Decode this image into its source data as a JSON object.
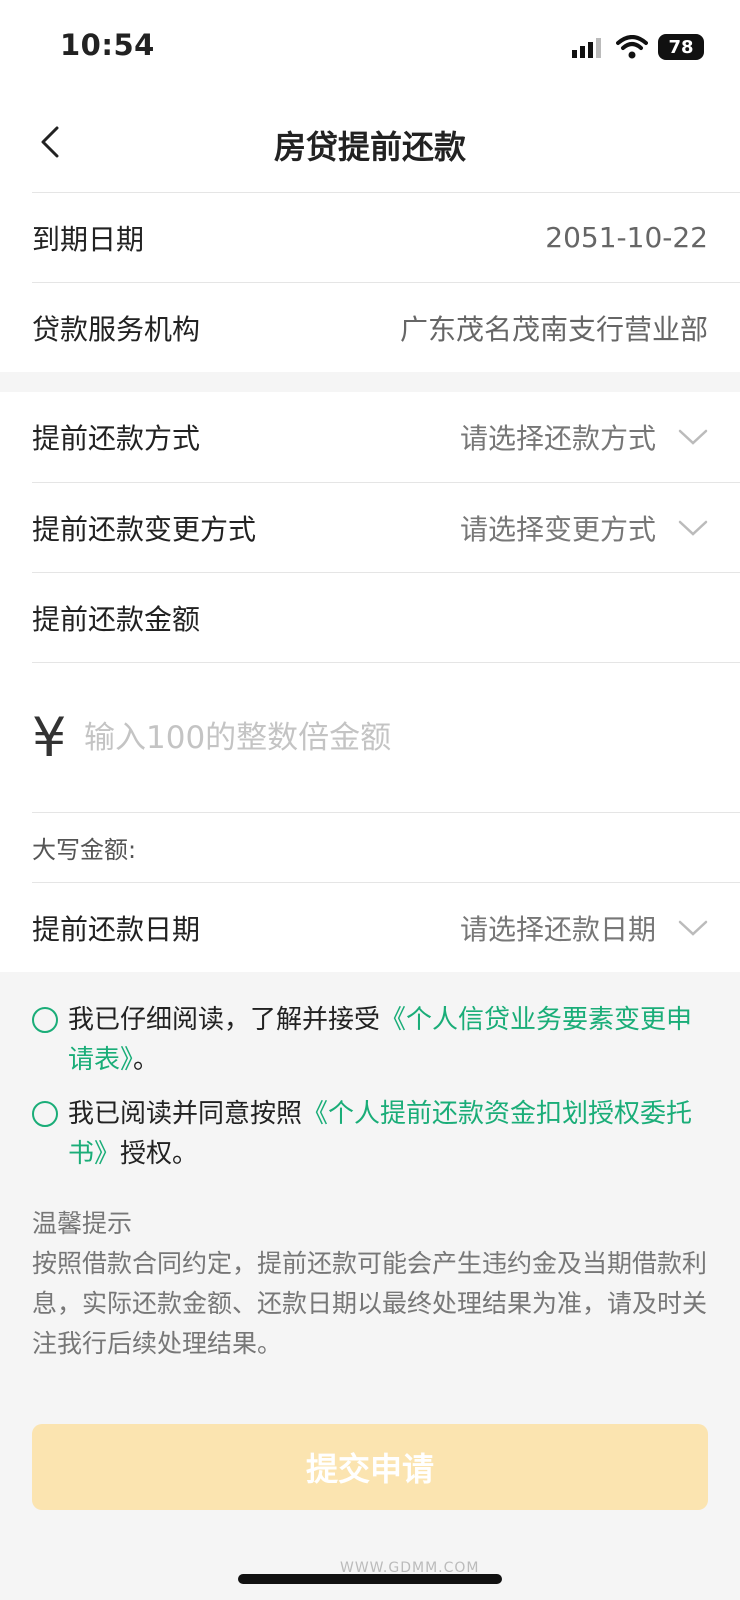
{
  "status": {
    "time": "10:54",
    "battery": "78"
  },
  "nav": {
    "title": "房贷提前还款"
  },
  "info": {
    "due_label": "到期日期",
    "due_value": "2051-10-22",
    "branch_label": "贷款服务机构",
    "branch_value": "广东茂名茂南支行营业部"
  },
  "form": {
    "method_label": "提前还款方式",
    "method_value": "请选择还款方式",
    "change_label": "提前还款变更方式",
    "change_value": "请选择变更方式",
    "amount_label": "提前还款金额",
    "currency": "¥",
    "amount_placeholder": "输入100的整数倍金额",
    "caps_label": "大写金额:",
    "date_label": "提前还款日期",
    "date_value": "请选择还款日期"
  },
  "agreements": [
    {
      "prefix": "我已仔细阅读，了解并接受",
      "link": "《个人信贷业务要素变更申请表》",
      "suffix": "。"
    },
    {
      "prefix": "我已阅读并同意按照",
      "link": "《个人提前还款资金扣划授权委托书》",
      "suffix": "授权。"
    }
  ],
  "tips": {
    "title": "温馨提示",
    "body": "按照借款合同约定，提前还款可能会产生违约金及当期借款利息，实际还款金额、还款日期以最终处理结果为准，请及时关注我行后续处理结果。"
  },
  "submit_label": "提交申请",
  "watermark": "WWW.GDMM.COM",
  "colors": {
    "accent": "#1aad78",
    "submit_disabled": "#fbe4b0"
  }
}
